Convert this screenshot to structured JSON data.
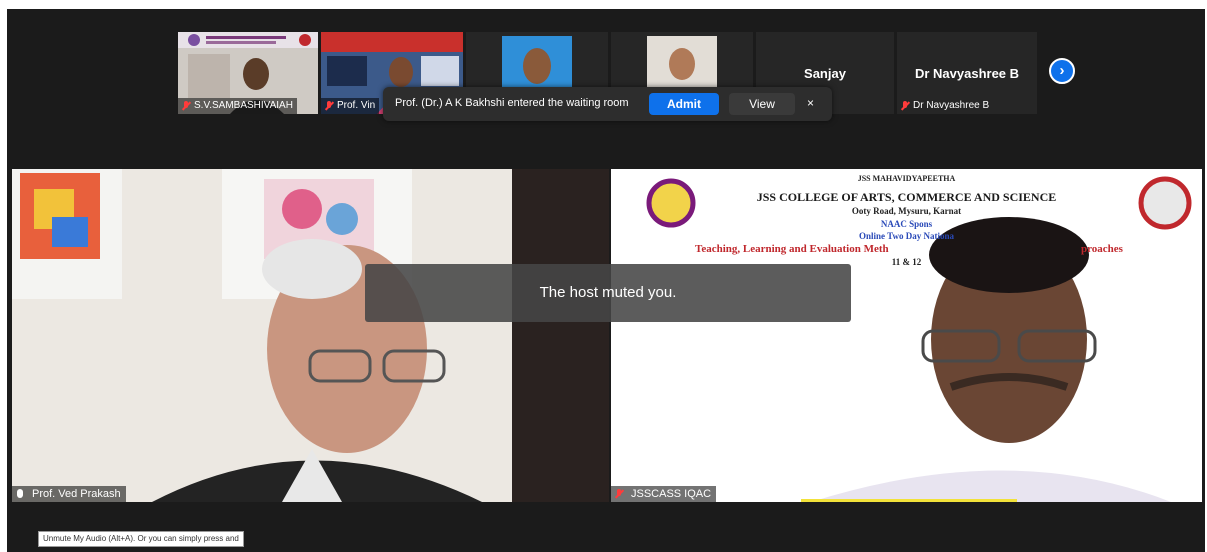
{
  "thumbnails": [
    {
      "name": "S.V.SAMBASHIVAIAH",
      "muted": true
    },
    {
      "name": "Prof. Vin",
      "muted": true
    },
    {
      "name": "",
      "muted": false
    },
    {
      "name": "",
      "muted": false
    },
    {
      "name": "Sanjay",
      "center_label": "Sanjay",
      "muted": false
    },
    {
      "name": "Dr Navyashree B",
      "center_label": "Dr Navyashree B",
      "muted": true
    }
  ],
  "notification": {
    "text": "Prof. (Dr.) A K Bakhshi entered the waiting room",
    "admit_label": "Admit",
    "view_label": "View",
    "close_symbol": "×"
  },
  "next_page_icon": "›",
  "main_tiles": {
    "left": {
      "name": "Prof. Ved Prakash"
    },
    "right": {
      "name": "JSSCASS IQAC",
      "banner": {
        "line1": "JSS MAHAVIDYAPEETHA",
        "line2": "JSS COLLEGE OF ARTS, COMMERCE AND SCIENCE",
        "line3": "Ooty Road, Mysuru, Karnat",
        "line4": "NAAC Spons",
        "line5": "Online Two Day Nationa",
        "line6": "Teaching, Learning and Evaluation Meth",
        "line6b": "proaches",
        "line7": "11 & 12"
      }
    }
  },
  "toast": "The host muted you.",
  "tooltip": "Unmute My Audio (Alt+A). Or you can simply press and",
  "colors": {
    "accent": "#0e71eb",
    "muted": "#ff3b3b",
    "background": "#1b1b1b"
  }
}
